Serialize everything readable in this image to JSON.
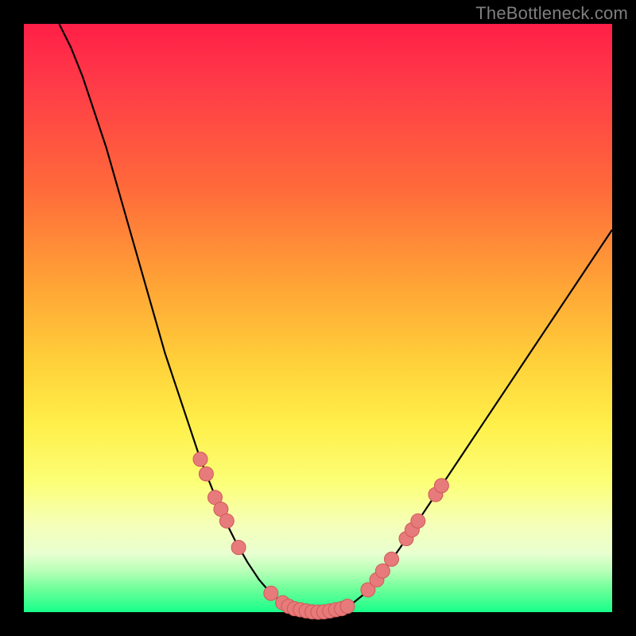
{
  "watermark": "TheBottleneck.com",
  "colors": {
    "curve_stroke": "#000000",
    "dot_fill": "#e77a7a",
    "dot_stroke": "#cf5a5a"
  },
  "chart_data": {
    "type": "line",
    "title": "",
    "xlabel": "",
    "ylabel": "",
    "xlim": [
      0,
      100
    ],
    "ylim": [
      0,
      100
    ],
    "curve": [
      {
        "x": 6,
        "y": 100
      },
      {
        "x": 8,
        "y": 96
      },
      {
        "x": 10,
        "y": 91
      },
      {
        "x": 12,
        "y": 85
      },
      {
        "x": 14,
        "y": 79
      },
      {
        "x": 16,
        "y": 72
      },
      {
        "x": 18,
        "y": 65
      },
      {
        "x": 20,
        "y": 58
      },
      {
        "x": 22,
        "y": 51
      },
      {
        "x": 24,
        "y": 44
      },
      {
        "x": 26,
        "y": 38
      },
      {
        "x": 28,
        "y": 32
      },
      {
        "x": 30,
        "y": 26
      },
      {
        "x": 32,
        "y": 21
      },
      {
        "x": 34,
        "y": 16
      },
      {
        "x": 36,
        "y": 12
      },
      {
        "x": 38,
        "y": 8.5
      },
      {
        "x": 40,
        "y": 5.5
      },
      {
        "x": 42,
        "y": 3.2
      },
      {
        "x": 44,
        "y": 1.6
      },
      {
        "x": 46,
        "y": 0.6
      },
      {
        "x": 48,
        "y": 0.15
      },
      {
        "x": 50,
        "y": 0
      },
      {
        "x": 52,
        "y": 0.15
      },
      {
        "x": 54,
        "y": 0.6
      },
      {
        "x": 56,
        "y": 1.6
      },
      {
        "x": 58,
        "y": 3.2
      },
      {
        "x": 60,
        "y": 5.5
      },
      {
        "x": 62,
        "y": 8.2
      },
      {
        "x": 64,
        "y": 11
      },
      {
        "x": 66,
        "y": 14
      },
      {
        "x": 68,
        "y": 17
      },
      {
        "x": 70,
        "y": 20
      },
      {
        "x": 72,
        "y": 23
      },
      {
        "x": 74,
        "y": 26
      },
      {
        "x": 76,
        "y": 29
      },
      {
        "x": 78,
        "y": 32
      },
      {
        "x": 80,
        "y": 35
      },
      {
        "x": 82,
        "y": 38
      },
      {
        "x": 84,
        "y": 41
      },
      {
        "x": 86,
        "y": 44
      },
      {
        "x": 88,
        "y": 47
      },
      {
        "x": 90,
        "y": 50
      },
      {
        "x": 92,
        "y": 53
      },
      {
        "x": 94,
        "y": 56
      },
      {
        "x": 96,
        "y": 59
      },
      {
        "x": 98,
        "y": 62
      },
      {
        "x": 100,
        "y": 65
      }
    ],
    "dots": [
      {
        "x": 30.0,
        "y": 26.0
      },
      {
        "x": 31.0,
        "y": 23.5
      },
      {
        "x": 32.5,
        "y": 19.5
      },
      {
        "x": 33.5,
        "y": 17.5
      },
      {
        "x": 34.5,
        "y": 15.5
      },
      {
        "x": 36.5,
        "y": 11.0
      },
      {
        "x": 42.0,
        "y": 3.2
      },
      {
        "x": 44.0,
        "y": 1.6
      },
      {
        "x": 45.0,
        "y": 1.0
      },
      {
        "x": 46.0,
        "y": 0.6
      },
      {
        "x": 47.0,
        "y": 0.4
      },
      {
        "x": 48.0,
        "y": 0.2
      },
      {
        "x": 49.0,
        "y": 0.05
      },
      {
        "x": 50.0,
        "y": 0.0
      },
      {
        "x": 51.0,
        "y": 0.05
      },
      {
        "x": 52.0,
        "y": 0.2
      },
      {
        "x": 53.0,
        "y": 0.4
      },
      {
        "x": 54.0,
        "y": 0.6
      },
      {
        "x": 55.0,
        "y": 1.0
      },
      {
        "x": 58.5,
        "y": 3.8
      },
      {
        "x": 60.0,
        "y": 5.5
      },
      {
        "x": 61.0,
        "y": 7.0
      },
      {
        "x": 62.5,
        "y": 9.0
      },
      {
        "x": 65.0,
        "y": 12.5
      },
      {
        "x": 66.0,
        "y": 14.0
      },
      {
        "x": 67.0,
        "y": 15.5
      },
      {
        "x": 70.0,
        "y": 20.0
      },
      {
        "x": 71.0,
        "y": 21.5
      }
    ]
  }
}
